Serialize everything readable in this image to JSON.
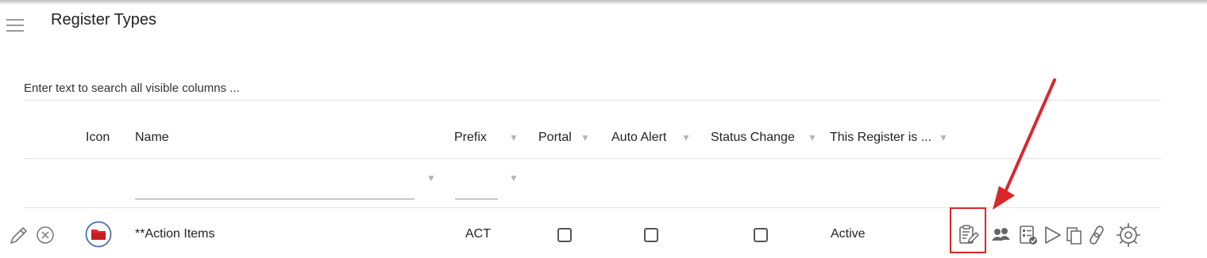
{
  "header": {
    "title": "Register Types"
  },
  "search": {
    "placeholder": "Enter text to search all visible columns ..."
  },
  "columns": {
    "icon": "Icon",
    "name": "Name",
    "prefix": "Prefix",
    "portal": "Portal",
    "auto_alert": "Auto Alert",
    "status_change": "Status Change",
    "this_register_is": "This Register is ..."
  },
  "rows": [
    {
      "name": "**Action Items",
      "prefix": "ACT",
      "portal": false,
      "auto_alert": false,
      "status_change": false,
      "status": "Active",
      "icon": "folder-icon"
    }
  ],
  "colors": {
    "highlight": "#d9272d",
    "arrow": "#d9272d",
    "folder": "#e0262c",
    "icon_gray": "#666666",
    "funnel": "#b5b5b5"
  },
  "row_actions": [
    "edit-register-icon",
    "users-icon",
    "checklist-icon",
    "play-icon",
    "copy-icon",
    "link-icon",
    "settings-gear-icon"
  ]
}
